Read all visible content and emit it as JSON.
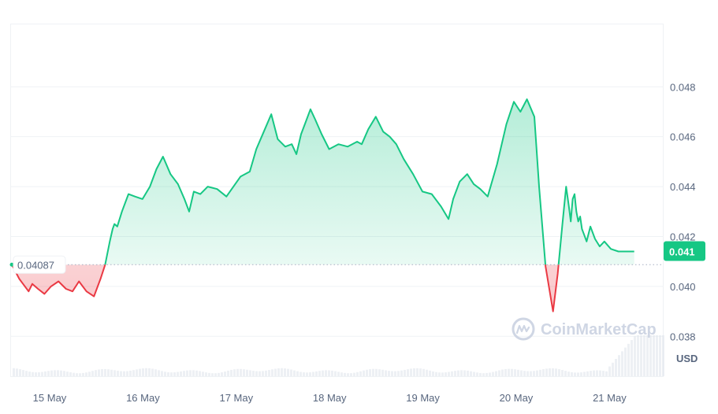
{
  "chart_data": {
    "type": "area",
    "x_ticks": [
      "15 May",
      "16 May",
      "17 May",
      "18 May",
      "19 May",
      "20 May",
      "21 May"
    ],
    "y_ticks": [
      "0.038",
      "0.040",
      "0.042",
      "0.044",
      "0.046",
      "0.048"
    ],
    "ylim": [
      0.0364,
      0.0505
    ],
    "xlim": [
      0,
      7
    ],
    "y_unit": "USD",
    "baseline": {
      "value": 0.04087,
      "label": "0.04087"
    },
    "current_price": {
      "value": 0.0414,
      "label": "0.041"
    },
    "watermark": "CoinMarketCap",
    "grid": true,
    "colors": {
      "up": "#16c784",
      "down": "#ea3943",
      "tag": "#16c784",
      "grid": "#eff2f5",
      "text": "#58667e"
    },
    "series": [
      {
        "x": [
          0.0,
          0.08,
          0.12,
          0.18,
          0.22,
          0.28,
          0.35,
          0.42,
          0.5,
          0.58,
          0.65,
          0.72,
          0.8,
          0.88,
          0.95,
          1.0,
          1.05,
          1.08,
          1.1,
          1.13,
          1.18,
          1.25,
          1.32,
          1.4,
          1.48,
          1.55,
          1.62,
          1.7,
          1.78,
          1.85,
          1.9,
          1.95,
          2.02,
          2.1,
          2.2,
          2.3,
          2.45,
          2.55,
          2.62,
          2.7,
          2.78,
          2.85,
          2.93,
          3.0,
          3.05,
          3.1,
          3.15,
          3.2,
          3.25,
          3.32,
          3.4,
          3.5,
          3.6,
          3.7,
          3.75,
          3.82,
          3.9,
          3.98,
          4.05,
          4.12,
          4.2,
          4.3,
          4.4,
          4.5,
          4.6,
          4.68,
          4.73,
          4.8,
          4.88,
          4.95,
          5.02,
          5.1,
          5.2,
          5.3,
          5.38,
          5.45,
          5.52,
          5.6,
          5.65,
          5.72,
          5.8,
          5.85,
          5.9,
          5.94,
          5.97,
          5.99,
          6.01,
          6.03,
          6.05,
          6.07,
          6.09,
          6.11,
          6.13,
          6.16,
          6.2,
          6.25,
          6.3,
          6.35,
          6.42,
          6.5,
          6.57,
          6.62,
          6.67
        ],
        "values": [
          0.04087,
          0.0403,
          0.0401,
          0.0398,
          0.0401,
          0.0399,
          0.0397,
          0.04,
          0.0402,
          0.0399,
          0.0398,
          0.0402,
          0.0398,
          0.0396,
          0.0403,
          0.04087,
          0.0418,
          0.0423,
          0.0425,
          0.0424,
          0.043,
          0.0437,
          0.0436,
          0.0435,
          0.044,
          0.0447,
          0.0452,
          0.0445,
          0.0441,
          0.0435,
          0.043,
          0.0438,
          0.0437,
          0.044,
          0.0439,
          0.0436,
          0.0444,
          0.0446,
          0.0455,
          0.0462,
          0.0469,
          0.0459,
          0.0456,
          0.0457,
          0.0453,
          0.0461,
          0.0466,
          0.0471,
          0.0467,
          0.0461,
          0.0455,
          0.0457,
          0.0456,
          0.0458,
          0.0457,
          0.0463,
          0.0468,
          0.0462,
          0.046,
          0.0457,
          0.0451,
          0.0445,
          0.0438,
          0.0437,
          0.0432,
          0.0427,
          0.0435,
          0.0442,
          0.0445,
          0.0441,
          0.0439,
          0.0436,
          0.0449,
          0.0465,
          0.0474,
          0.047,
          0.0475,
          0.0468,
          0.044,
          0.0408,
          0.039,
          0.0405,
          0.0425,
          0.044,
          0.0432,
          0.0426,
          0.0435,
          0.0437,
          0.043,
          0.0426,
          0.0428,
          0.0423,
          0.0421,
          0.0418,
          0.0424,
          0.0419,
          0.0416,
          0.0418,
          0.0415,
          0.0414,
          0.0414,
          0.0414,
          0.0414
        ]
      }
    ]
  }
}
